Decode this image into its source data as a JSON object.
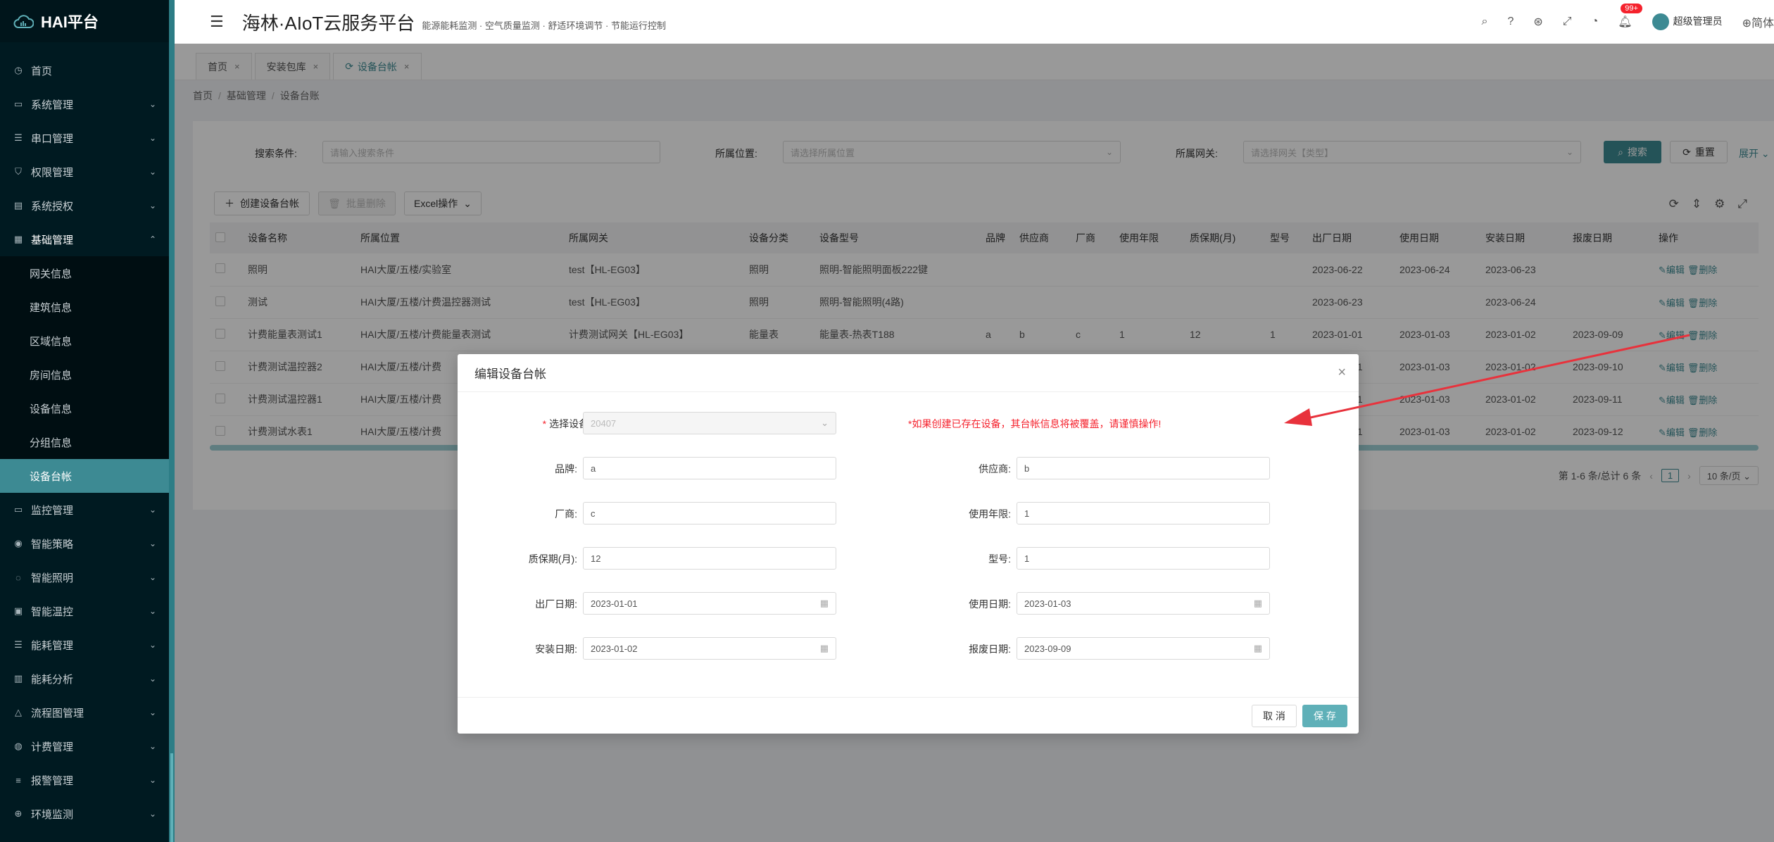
{
  "sidebar": {
    "logo": "HAI平台",
    "items": [
      {
        "label": "首页",
        "icon": "clock-icon"
      },
      {
        "label": "系统管理",
        "icon": "monitor-icon"
      },
      {
        "label": "串口管理",
        "icon": "sliders-icon"
      },
      {
        "label": "权限管理",
        "icon": "shield-icon"
      },
      {
        "label": "系统授权",
        "icon": "file-icon"
      },
      {
        "label": "基础管理",
        "icon": "table-icon"
      }
    ],
    "sub_items": [
      "网关信息",
      "建筑信息",
      "区域信息",
      "房间信息",
      "设备信息",
      "分组信息",
      "设备台帐"
    ],
    "bottom_items": [
      {
        "label": "监控管理",
        "icon": "monitor-icon"
      },
      {
        "label": "智能策略",
        "icon": "bulb-icon"
      },
      {
        "label": "智能照明",
        "icon": "bulb-icon"
      },
      {
        "label": "智能温控",
        "icon": "thermo-icon"
      },
      {
        "label": "能耗管理",
        "icon": "sliders-icon"
      },
      {
        "label": "能耗分析",
        "icon": "chart-icon"
      },
      {
        "label": "流程图管理",
        "icon": "flow-icon"
      },
      {
        "label": "计费管理",
        "icon": "coin-icon"
      },
      {
        "label": "报警管理",
        "icon": "alarm-icon"
      },
      {
        "label": "环境监测",
        "icon": "env-icon"
      }
    ]
  },
  "header": {
    "title": "海林·AIoT云服务平台",
    "subtitle": "能源能耗监测 · 空气质量监测 · 舒适环境调节 · 节能运行控制",
    "badge": "99+",
    "user": "超级管理员",
    "extra": "简体"
  },
  "tabs": [
    {
      "label": "首页",
      "close": "×"
    },
    {
      "label": "安装包库",
      "close": "×"
    },
    {
      "label": "设备台帐",
      "close": "×"
    }
  ],
  "breadcrumb": [
    "首页",
    "基础管理",
    "设备台账"
  ],
  "search": {
    "cond_label": "搜索条件:",
    "cond_placeholder": "请输入搜索条件",
    "location_label": "所属位置:",
    "location_placeholder": "请选择所属位置",
    "gateway_label": "所属网关:",
    "gateway_placeholder": "请选择网关【类型】",
    "search_btn": "搜索",
    "reset_btn": "重置",
    "expand": "展开"
  },
  "toolbar": {
    "create": "创建设备台帐",
    "batch_delete": "批量删除",
    "excel": "Excel操作"
  },
  "table": {
    "headers": [
      "设备名称",
      "所属位置",
      "所属网关",
      "设备分类",
      "设备型号",
      "品牌",
      "供应商",
      "厂商",
      "使用年限",
      "质保期(月)",
      "型号",
      "出厂日期",
      "使用日期",
      "安装日期",
      "报废日期",
      "操作"
    ],
    "rows": [
      [
        "照明",
        "HAI大厦/五楼/实验室",
        "test【HL-EG03】",
        "照明",
        "照明-智能照明面板222键",
        "",
        "",
        "",
        "",
        "",
        "",
        "2023-06-22",
        "2023-06-24",
        "2023-06-23",
        ""
      ],
      [
        "测试",
        "HAI大厦/五楼/计费温控器测试",
        "test【HL-EG03】",
        "照明",
        "照明-智能照明(4路)",
        "",
        "",
        "",
        "",
        "",
        "",
        "2023-06-23",
        "",
        "2023-06-24",
        ""
      ],
      [
        "计费能量表测试1",
        "HAI大厦/五楼/计费能量表测试",
        "计费测试网关【HL-EG03】",
        "能量表",
        "能量表-热表T188",
        "a",
        "b",
        "c",
        "1",
        "12",
        "1",
        "2023-01-01",
        "2023-01-03",
        "2023-01-02",
        "2023-09-09"
      ],
      [
        "计费测试温控器2",
        "HAI大厦/五楼/计费",
        "",
        "",
        "",
        "",
        "",
        "",
        "",
        "",
        "",
        "2023-01-01",
        "2023-01-03",
        "2023-01-02",
        "2023-09-10"
      ],
      [
        "计费测试温控器1",
        "HAI大厦/五楼/计费",
        "",
        "",
        "",
        "",
        "",
        "",
        "",
        "",
        "",
        "2023-01-01",
        "2023-01-03",
        "2023-01-02",
        "2023-09-11"
      ],
      [
        "计费测试水表1",
        "HAI大厦/五楼/计费",
        "",
        "",
        "",
        "",
        "",
        "",
        "",
        "",
        "",
        "2023-01-01",
        "2023-01-03",
        "2023-01-02",
        "2023-09-12"
      ]
    ],
    "edit": "编辑",
    "delete": "删除"
  },
  "pager": {
    "summary": "第 1-6 条/总计 6 条",
    "current": "1",
    "size": "10 条/页"
  },
  "modal": {
    "title": "编辑设备台帐",
    "device_label": "选择设备:",
    "device_value": "20407",
    "warning": "*如果创建已存在设备，其台帐信息将被覆盖，请谨慎操作!",
    "brand_label": "品牌:",
    "brand_value": "a",
    "supplier_label": "供应商:",
    "supplier_value": "b",
    "vendor_label": "厂商:",
    "vendor_value": "c",
    "years_label": "使用年限:",
    "years_value": "1",
    "warranty_label": "质保期(月):",
    "warranty_value": "12",
    "model_label": "型号:",
    "model_value": "1",
    "factory_label": "出厂日期:",
    "factory_value": "2023-01-01",
    "use_label": "使用日期:",
    "use_value": "2023-01-03",
    "install_label": "安装日期:",
    "install_value": "2023-01-02",
    "scrap_label": "报废日期:",
    "scrap_value": "2023-09-09",
    "cancel": "取 消",
    "save": "保 存"
  },
  "colors": {
    "accent": "#3d8a93",
    "sidebar_bg": "#001a21",
    "warning": "#f5222d",
    "annotation_arrow": "#e8323c"
  }
}
